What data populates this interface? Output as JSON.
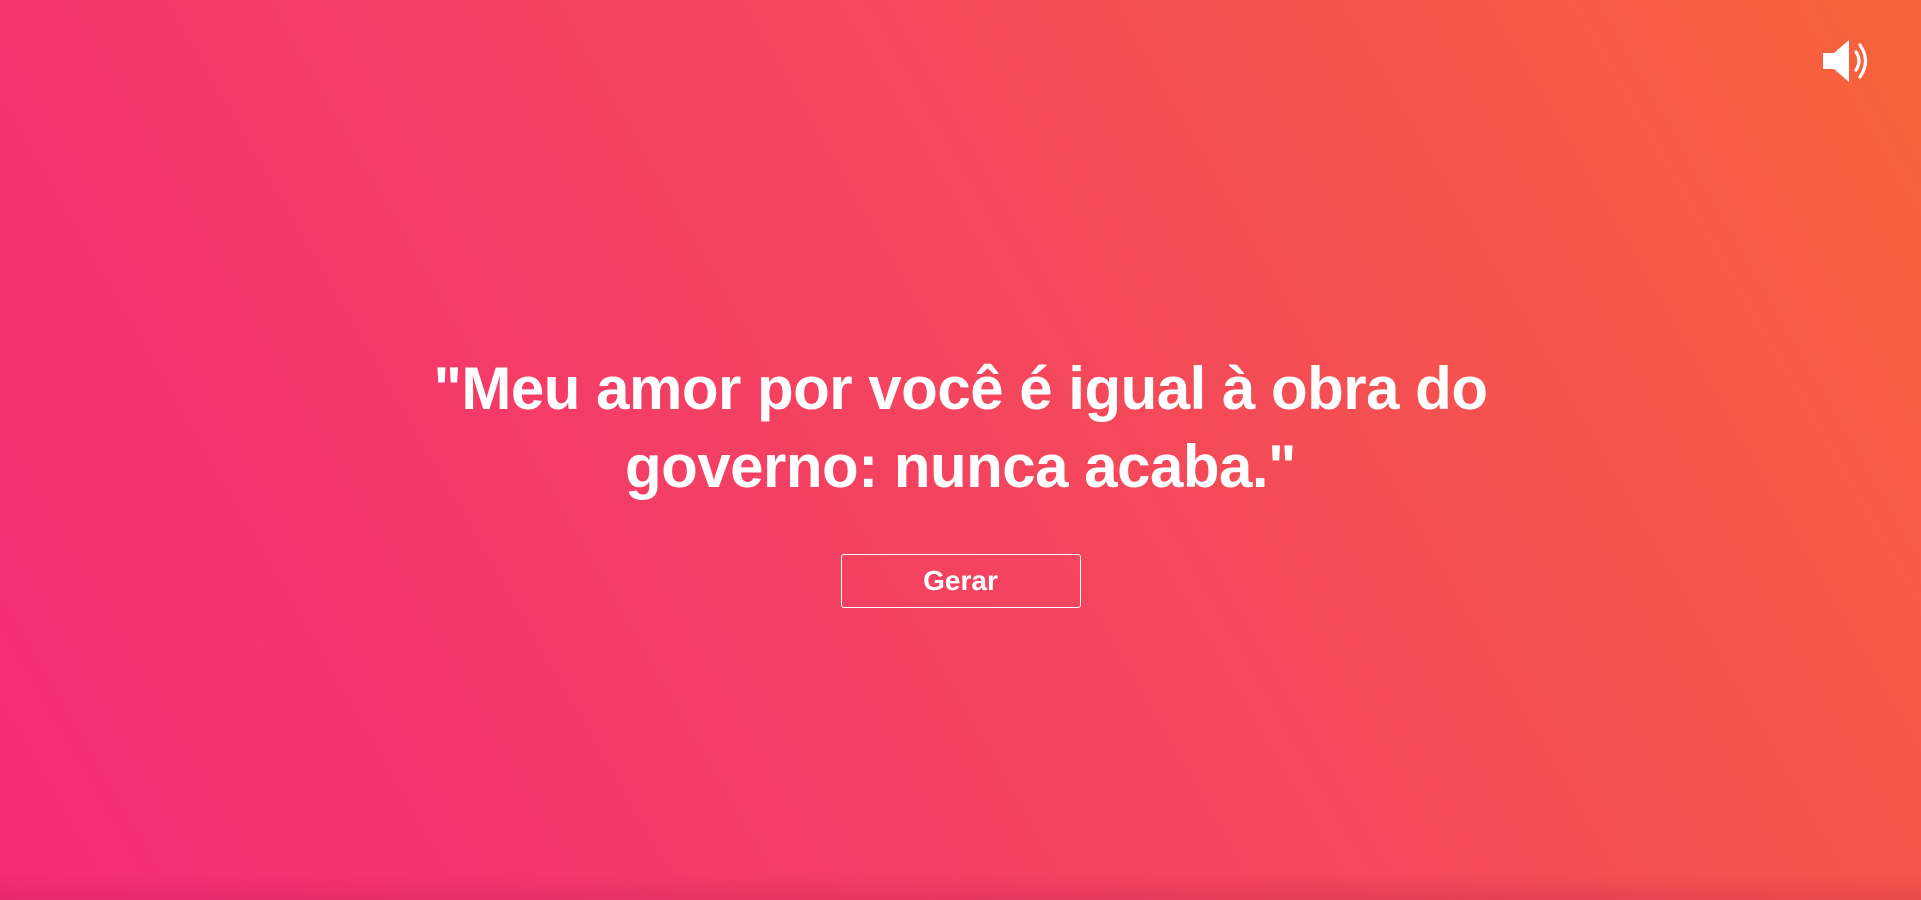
{
  "quote": {
    "text": "\"Meu amor por você é igual à obra do governo: nunca acaba.\""
  },
  "controls": {
    "generate_label": "Gerar",
    "sound_icon": "speaker-volume-icon"
  },
  "theme": {
    "gradient_start": "#f52b78",
    "gradient_mid": "#f4475c",
    "gradient_end": "#f6643a",
    "text_color": "#ffffff"
  }
}
